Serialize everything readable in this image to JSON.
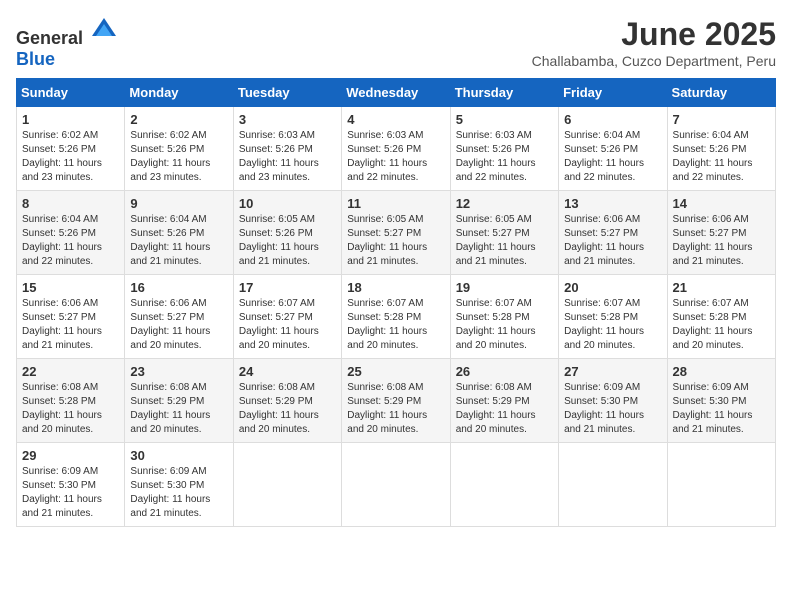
{
  "logo": {
    "general": "General",
    "blue": "Blue"
  },
  "title": "June 2025",
  "location": "Challabamba, Cuzco Department, Peru",
  "headers": [
    "Sunday",
    "Monday",
    "Tuesday",
    "Wednesday",
    "Thursday",
    "Friday",
    "Saturday"
  ],
  "weeks": [
    [
      {
        "day": "1",
        "sunrise": "6:02 AM",
        "sunset": "5:26 PM",
        "daylight": "11 hours and 23 minutes."
      },
      {
        "day": "2",
        "sunrise": "6:02 AM",
        "sunset": "5:26 PM",
        "daylight": "11 hours and 23 minutes."
      },
      {
        "day": "3",
        "sunrise": "6:03 AM",
        "sunset": "5:26 PM",
        "daylight": "11 hours and 23 minutes."
      },
      {
        "day": "4",
        "sunrise": "6:03 AM",
        "sunset": "5:26 PM",
        "daylight": "11 hours and 22 minutes."
      },
      {
        "day": "5",
        "sunrise": "6:03 AM",
        "sunset": "5:26 PM",
        "daylight": "11 hours and 22 minutes."
      },
      {
        "day": "6",
        "sunrise": "6:04 AM",
        "sunset": "5:26 PM",
        "daylight": "11 hours and 22 minutes."
      },
      {
        "day": "7",
        "sunrise": "6:04 AM",
        "sunset": "5:26 PM",
        "daylight": "11 hours and 22 minutes."
      }
    ],
    [
      {
        "day": "8",
        "sunrise": "6:04 AM",
        "sunset": "5:26 PM",
        "daylight": "11 hours and 22 minutes."
      },
      {
        "day": "9",
        "sunrise": "6:04 AM",
        "sunset": "5:26 PM",
        "daylight": "11 hours and 21 minutes."
      },
      {
        "day": "10",
        "sunrise": "6:05 AM",
        "sunset": "5:26 PM",
        "daylight": "11 hours and 21 minutes."
      },
      {
        "day": "11",
        "sunrise": "6:05 AM",
        "sunset": "5:27 PM",
        "daylight": "11 hours and 21 minutes."
      },
      {
        "day": "12",
        "sunrise": "6:05 AM",
        "sunset": "5:27 PM",
        "daylight": "11 hours and 21 minutes."
      },
      {
        "day": "13",
        "sunrise": "6:06 AM",
        "sunset": "5:27 PM",
        "daylight": "11 hours and 21 minutes."
      },
      {
        "day": "14",
        "sunrise": "6:06 AM",
        "sunset": "5:27 PM",
        "daylight": "11 hours and 21 minutes."
      }
    ],
    [
      {
        "day": "15",
        "sunrise": "6:06 AM",
        "sunset": "5:27 PM",
        "daylight": "11 hours and 21 minutes."
      },
      {
        "day": "16",
        "sunrise": "6:06 AM",
        "sunset": "5:27 PM",
        "daylight": "11 hours and 20 minutes."
      },
      {
        "day": "17",
        "sunrise": "6:07 AM",
        "sunset": "5:27 PM",
        "daylight": "11 hours and 20 minutes."
      },
      {
        "day": "18",
        "sunrise": "6:07 AM",
        "sunset": "5:28 PM",
        "daylight": "11 hours and 20 minutes."
      },
      {
        "day": "19",
        "sunrise": "6:07 AM",
        "sunset": "5:28 PM",
        "daylight": "11 hours and 20 minutes."
      },
      {
        "day": "20",
        "sunrise": "6:07 AM",
        "sunset": "5:28 PM",
        "daylight": "11 hours and 20 minutes."
      },
      {
        "day": "21",
        "sunrise": "6:07 AM",
        "sunset": "5:28 PM",
        "daylight": "11 hours and 20 minutes."
      }
    ],
    [
      {
        "day": "22",
        "sunrise": "6:08 AM",
        "sunset": "5:28 PM",
        "daylight": "11 hours and 20 minutes."
      },
      {
        "day": "23",
        "sunrise": "6:08 AM",
        "sunset": "5:29 PM",
        "daylight": "11 hours and 20 minutes."
      },
      {
        "day": "24",
        "sunrise": "6:08 AM",
        "sunset": "5:29 PM",
        "daylight": "11 hours and 20 minutes."
      },
      {
        "day": "25",
        "sunrise": "6:08 AM",
        "sunset": "5:29 PM",
        "daylight": "11 hours and 20 minutes."
      },
      {
        "day": "26",
        "sunrise": "6:08 AM",
        "sunset": "5:29 PM",
        "daylight": "11 hours and 20 minutes."
      },
      {
        "day": "27",
        "sunrise": "6:09 AM",
        "sunset": "5:30 PM",
        "daylight": "11 hours and 21 minutes."
      },
      {
        "day": "28",
        "sunrise": "6:09 AM",
        "sunset": "5:30 PM",
        "daylight": "11 hours and 21 minutes."
      }
    ],
    [
      {
        "day": "29",
        "sunrise": "6:09 AM",
        "sunset": "5:30 PM",
        "daylight": "11 hours and 21 minutes."
      },
      {
        "day": "30",
        "sunrise": "6:09 AM",
        "sunset": "5:30 PM",
        "daylight": "11 hours and 21 minutes."
      },
      null,
      null,
      null,
      null,
      null
    ]
  ]
}
